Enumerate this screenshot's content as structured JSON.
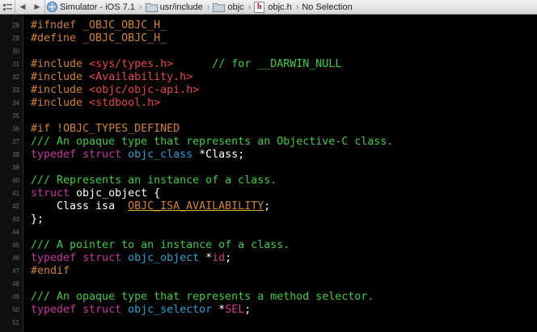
{
  "jumpbar": {
    "crumbs": [
      "Simulator - iOS 7.1",
      "usr/include",
      "objc",
      "objc.h",
      "No Selection"
    ]
  },
  "colors": {
    "preprocessor": "#d38135",
    "string": "#e8454f",
    "comment": "#41cc45",
    "keyword": "#c536a6",
    "type": "#2b9ed6",
    "plain": "#ffffff",
    "background": "#000000"
  },
  "code": [
    {
      "n": "28",
      "t": [
        [
          "prep",
          "#ifndef _OBJC_OBJC_H_"
        ]
      ]
    },
    {
      "n": "29",
      "t": [
        [
          "prep",
          "#define _OBJC_OBJC_H_"
        ]
      ]
    },
    {
      "n": "30",
      "t": []
    },
    {
      "n": "31",
      "t": [
        [
          "prep",
          "#include "
        ],
        [
          "str",
          "<sys/types.h>"
        ],
        [
          "pln",
          "      "
        ],
        [
          "com",
          "// for __DARWIN_NULL"
        ]
      ]
    },
    {
      "n": "32",
      "t": [
        [
          "prep",
          "#include "
        ],
        [
          "str",
          "<Availability.h>"
        ]
      ]
    },
    {
      "n": "33",
      "t": [
        [
          "prep",
          "#include "
        ],
        [
          "str",
          "<objc/objc-api.h>"
        ]
      ]
    },
    {
      "n": "34",
      "t": [
        [
          "prep",
          "#include "
        ],
        [
          "str",
          "<stdbool.h>"
        ]
      ]
    },
    {
      "n": "35",
      "t": []
    },
    {
      "n": "36",
      "t": [
        [
          "prep",
          "#if !OBJC_TYPES_DEFINED"
        ]
      ]
    },
    {
      "n": "37",
      "t": [
        [
          "com",
          "/// An opaque type that represents an Objective-C class."
        ]
      ]
    },
    {
      "n": "38",
      "t": [
        [
          "kw",
          "typedef struct "
        ],
        [
          "type",
          "objc_class"
        ],
        [
          "pln",
          " *Class;"
        ]
      ]
    },
    {
      "n": "39",
      "t": []
    },
    {
      "n": "40",
      "t": [
        [
          "com",
          "/// Represents an instance of a class."
        ]
      ]
    },
    {
      "n": "41",
      "t": [
        [
          "kw",
          "struct "
        ],
        [
          "pln",
          "objc_object {"
        ]
      ]
    },
    {
      "n": "42",
      "t": [
        [
          "pln",
          "    Class isa  "
        ],
        [
          "mac",
          "OBJC_ISA_AVAILABILITY"
        ],
        [
          "pln",
          ";"
        ]
      ]
    },
    {
      "n": "43",
      "t": [
        [
          "pln",
          "};"
        ]
      ]
    },
    {
      "n": "44",
      "t": []
    },
    {
      "n": "45",
      "t": [
        [
          "com",
          "/// A pointer to an instance of a class."
        ]
      ]
    },
    {
      "n": "46",
      "t": [
        [
          "kw",
          "typedef struct "
        ],
        [
          "type",
          "objc_object"
        ],
        [
          "pln",
          " *"
        ],
        [
          "var",
          "id"
        ],
        [
          "pln",
          ";"
        ]
      ]
    },
    {
      "n": "47",
      "t": [
        [
          "prep",
          "#endif"
        ]
      ]
    },
    {
      "n": "48",
      "t": []
    },
    {
      "n": "49",
      "t": [
        [
          "com",
          "/// An opaque type that represents a method selector."
        ]
      ]
    },
    {
      "n": "50",
      "t": [
        [
          "kw",
          "typedef struct "
        ],
        [
          "type",
          "objc_selector"
        ],
        [
          "pln",
          " *"
        ],
        [
          "var",
          "SEL"
        ],
        [
          "pln",
          ";"
        ]
      ]
    },
    {
      "n": "51",
      "t": []
    }
  ]
}
